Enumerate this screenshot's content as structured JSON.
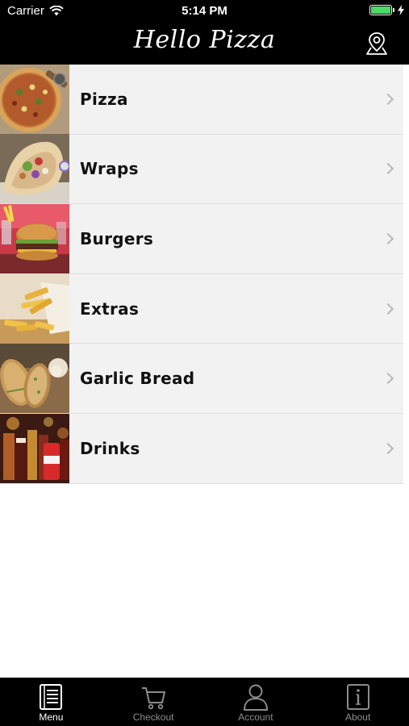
{
  "status_bar": {
    "carrier": "Carrier",
    "time": "5:14 PM"
  },
  "header": {
    "title": "Hello Pizza",
    "location_icon": "location-pin-icon"
  },
  "menu": {
    "items": [
      {
        "label": "Pizza",
        "thumb": "pizza-photo"
      },
      {
        "label": "Wraps",
        "thumb": "wraps-photo"
      },
      {
        "label": "Burgers",
        "thumb": "burgers-photo"
      },
      {
        "label": "Extras",
        "thumb": "fries-photo"
      },
      {
        "label": "Garlic Bread",
        "thumb": "garlic-bread-photo"
      },
      {
        "label": "Drinks",
        "thumb": "drinks-photo"
      }
    ]
  },
  "tab_bar": {
    "tabs": [
      {
        "label": "Menu",
        "icon": "menu-list-icon",
        "active": true
      },
      {
        "label": "Checkout",
        "icon": "cart-icon",
        "active": false
      },
      {
        "label": "Account",
        "icon": "person-icon",
        "active": false
      },
      {
        "label": "About",
        "icon": "info-icon",
        "active": false
      }
    ]
  },
  "colors": {
    "bars": "#000000",
    "row_background": "#f2f2f2",
    "battery": "#4cd964",
    "tab_active": "#ffffff",
    "tab_inactive": "#8c8c8c"
  }
}
